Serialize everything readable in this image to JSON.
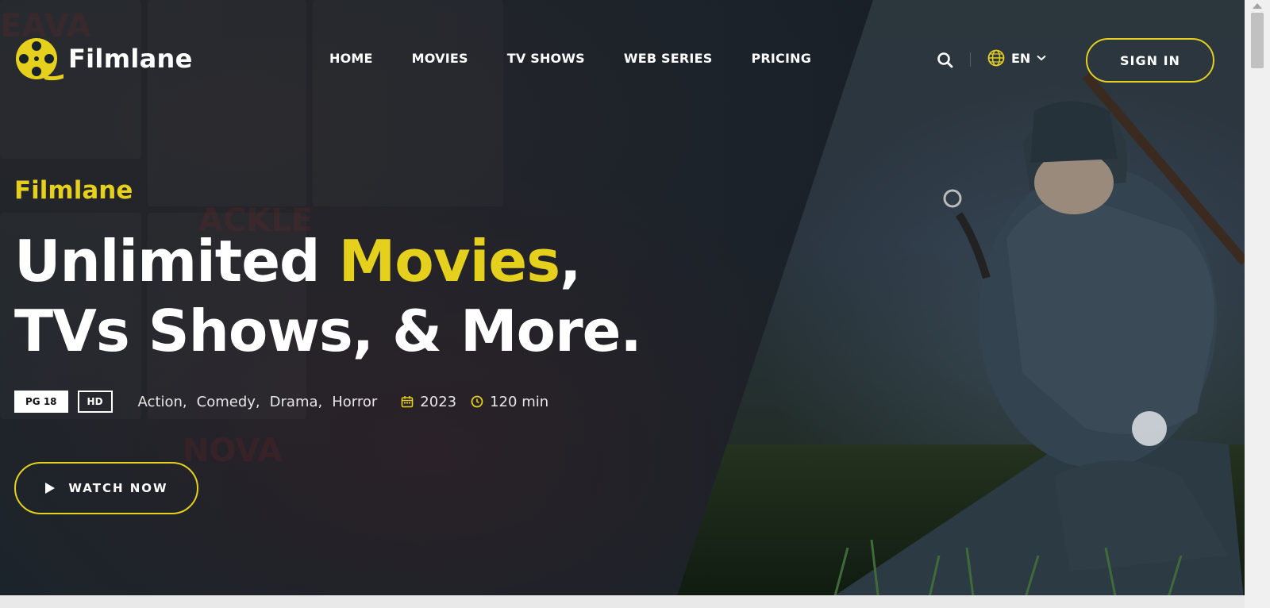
{
  "brand": {
    "name": "Filmlane",
    "accent_color": "#e4d01d",
    "logo_icon": "film-reel-icon"
  },
  "nav": {
    "items": [
      {
        "label": "HOME"
      },
      {
        "label": "MOVIES"
      },
      {
        "label": "TV SHOWS"
      },
      {
        "label": "WEB SERIES"
      },
      {
        "label": "PRICING"
      }
    ]
  },
  "header": {
    "search_icon": "search-icon",
    "language": {
      "icon": "globe-icon",
      "label": "EN",
      "chevron": "chevron-down-icon"
    },
    "signin_label": "SIGN IN"
  },
  "hero": {
    "subtitle": "Filmlane",
    "title_part1": "Unlimited ",
    "title_accent": "Movies",
    "title_part2": ",",
    "title_line2": "TVs Shows, & More.",
    "badges": {
      "rating": "PG 18",
      "quality": "HD"
    },
    "genres": [
      "Action,",
      "Comedy,",
      "Drama,",
      "Horror"
    ],
    "year": "2023",
    "duration": "120 min",
    "cta_label": "WATCH NOW",
    "cta_icon": "play-icon"
  },
  "colors": {
    "background": "#18222a",
    "text": "#ffffff"
  }
}
